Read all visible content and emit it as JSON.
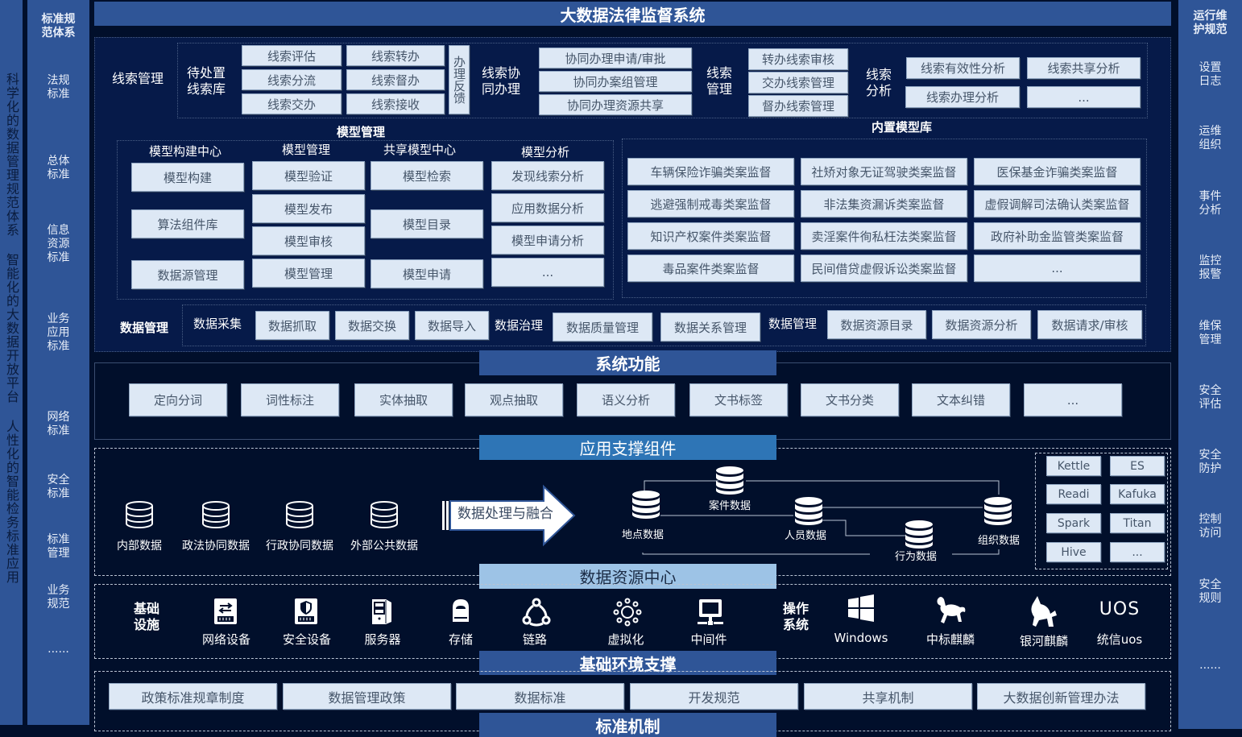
{
  "title": "大数据法律监督系统",
  "left_vertical_text": "科学化的数据管理规范体系 智能化的大数据开放平台 人性化的智能检务标准应用",
  "left_sidebar": {
    "header": "标准规\n范体系",
    "items": [
      "法规\n标准",
      "总体\n标准",
      "信息\n资源\n标准",
      "业务\n应用\n标准",
      "网络\n标准",
      "安全\n标准",
      "标准\n管理",
      "业务\n规范",
      "......"
    ]
  },
  "right_sidebar": {
    "header": "运行维\n护规范",
    "items": [
      "设置\n日志",
      "运维\n组织",
      "事件\n分析",
      "监控\n报警",
      "维保\n管理",
      "安全\n评估",
      "安全\n防护",
      "控制\n访问",
      "安全\n规则",
      "......"
    ]
  },
  "clue_management": {
    "label": "线索管理",
    "pending_library": {
      "label": "待处置\n线索库",
      "col1": [
        "线索评估",
        "线索分流",
        "线索交办"
      ],
      "col2": [
        "线索转办",
        "线索督办",
        "线索接收"
      ],
      "feedback": "办理反馈"
    },
    "collaboration": {
      "label": "线索协\n同办理",
      "items": [
        "协同办理申请/审批",
        "协同办案组管理",
        "协同办理资源共享"
      ]
    },
    "management": {
      "label": "线索\n管理",
      "items": [
        "转办线索审核",
        "交办线索管理",
        "督办线索管理"
      ]
    },
    "analysis": {
      "label": "线索\n分析",
      "items": [
        "线索有效性分析",
        "线索共享分析",
        "线索办理分析",
        "..."
      ]
    }
  },
  "model_management": {
    "title": "模型管理",
    "columns": [
      {
        "header": "模型构建中心",
        "items": [
          "模型构建",
          "算法组件库",
          "数据源管理"
        ]
      },
      {
        "header": "模型管理",
        "items": [
          "模型验证",
          "模型发布",
          "模型审核",
          "模型管理"
        ]
      },
      {
        "header": "共享模型中心",
        "items": [
          "模型检索",
          "模型目录",
          "模型申请"
        ]
      },
      {
        "header": "模型分析",
        "items": [
          "发现线索分析",
          "应用数据分析",
          "模型申请分析",
          "..."
        ]
      }
    ]
  },
  "builtin_models": {
    "title": "内置模型库",
    "items": [
      "车辆保险诈骗类案监督",
      "社矫对象无证驾驶类案监督",
      "医保基金诈骗类案监督",
      "逃避强制戒毒类案监督",
      "非法集资漏诉类案监督",
      "虚假调解司法确认类案监督",
      "知识产权案件类案监督",
      "卖淫案件徇私枉法类案监督",
      "政府补助金监管类案监督",
      "毒品案件类案监督",
      "民间借贷虚假诉讼类案监督",
      "..."
    ]
  },
  "data_management": {
    "label": "数据管理",
    "groups": [
      {
        "label": "数据采集",
        "items": [
          "数据抓取",
          "数据交换",
          "数据导入"
        ]
      },
      {
        "label": "数据治理",
        "items": [
          "数据质量管理",
          "数据关系管理"
        ]
      },
      {
        "label": "数据管理",
        "items": [
          "数据资源目录",
          "数据资源分析",
          "数据请求/审核"
        ]
      }
    ]
  },
  "system_functions": {
    "title": "系统功能",
    "items": [
      "定向分词",
      "词性标注",
      "实体抽取",
      "观点抽取",
      "语义分析",
      "文书标签",
      "文书分类",
      "文本纠错",
      "..."
    ]
  },
  "app_support": {
    "title": "应用支撑组件",
    "sources": [
      "内部数据",
      "政法协同数据",
      "行政协同数据",
      "外部公共数据"
    ],
    "arrow_label": "数据处理与融合",
    "graph_nodes": [
      "案件数据",
      "地点数据",
      "人员数据",
      "行为数据",
      "组织数据"
    ],
    "tools": [
      "Kettle",
      "ES",
      "Readi",
      "Kafuka",
      "Spark",
      "Titan",
      "Hive",
      "..."
    ]
  },
  "data_resource_center": {
    "title": "数据资源中心",
    "infra_label": "基础\n设施",
    "infra_items": [
      {
        "icon": "network-device-icon",
        "label": "网络设备"
      },
      {
        "icon": "security-device-icon",
        "label": "安全设备"
      },
      {
        "icon": "server-icon",
        "label": "服务器"
      },
      {
        "icon": "storage-icon",
        "label": "存储"
      },
      {
        "icon": "link-icon",
        "label": "链路"
      },
      {
        "icon": "virtualization-icon",
        "label": "虚拟化"
      },
      {
        "icon": "middleware-icon",
        "label": "中间件"
      }
    ],
    "os_label": "操作\n系统",
    "os_items": [
      {
        "icon": "windows-icon",
        "label": "Windows"
      },
      {
        "icon": "kylin-icon",
        "label": "中标麒麟"
      },
      {
        "icon": "galaxy-kylin-icon",
        "label": "银河麒麟"
      },
      {
        "icon": "uos-icon",
        "label": "统信uos",
        "logo_text": "UOS"
      }
    ]
  },
  "infra_support": {
    "title": "基础环境支撑"
  },
  "standards": {
    "title": "标准机制",
    "items": [
      "政策标准规章制度",
      "数据管理政策",
      "数据标准",
      "开发规范",
      "共享机制",
      "大数据创新管理办法"
    ]
  },
  "colors": {
    "background": "#010f2b",
    "panel": "#061a49",
    "band_dark": "#2f5597",
    "band_mid": "#2e75b6",
    "band_light": "#9dc3e6",
    "box": "#dde8f5",
    "box_text": "#46566a"
  }
}
